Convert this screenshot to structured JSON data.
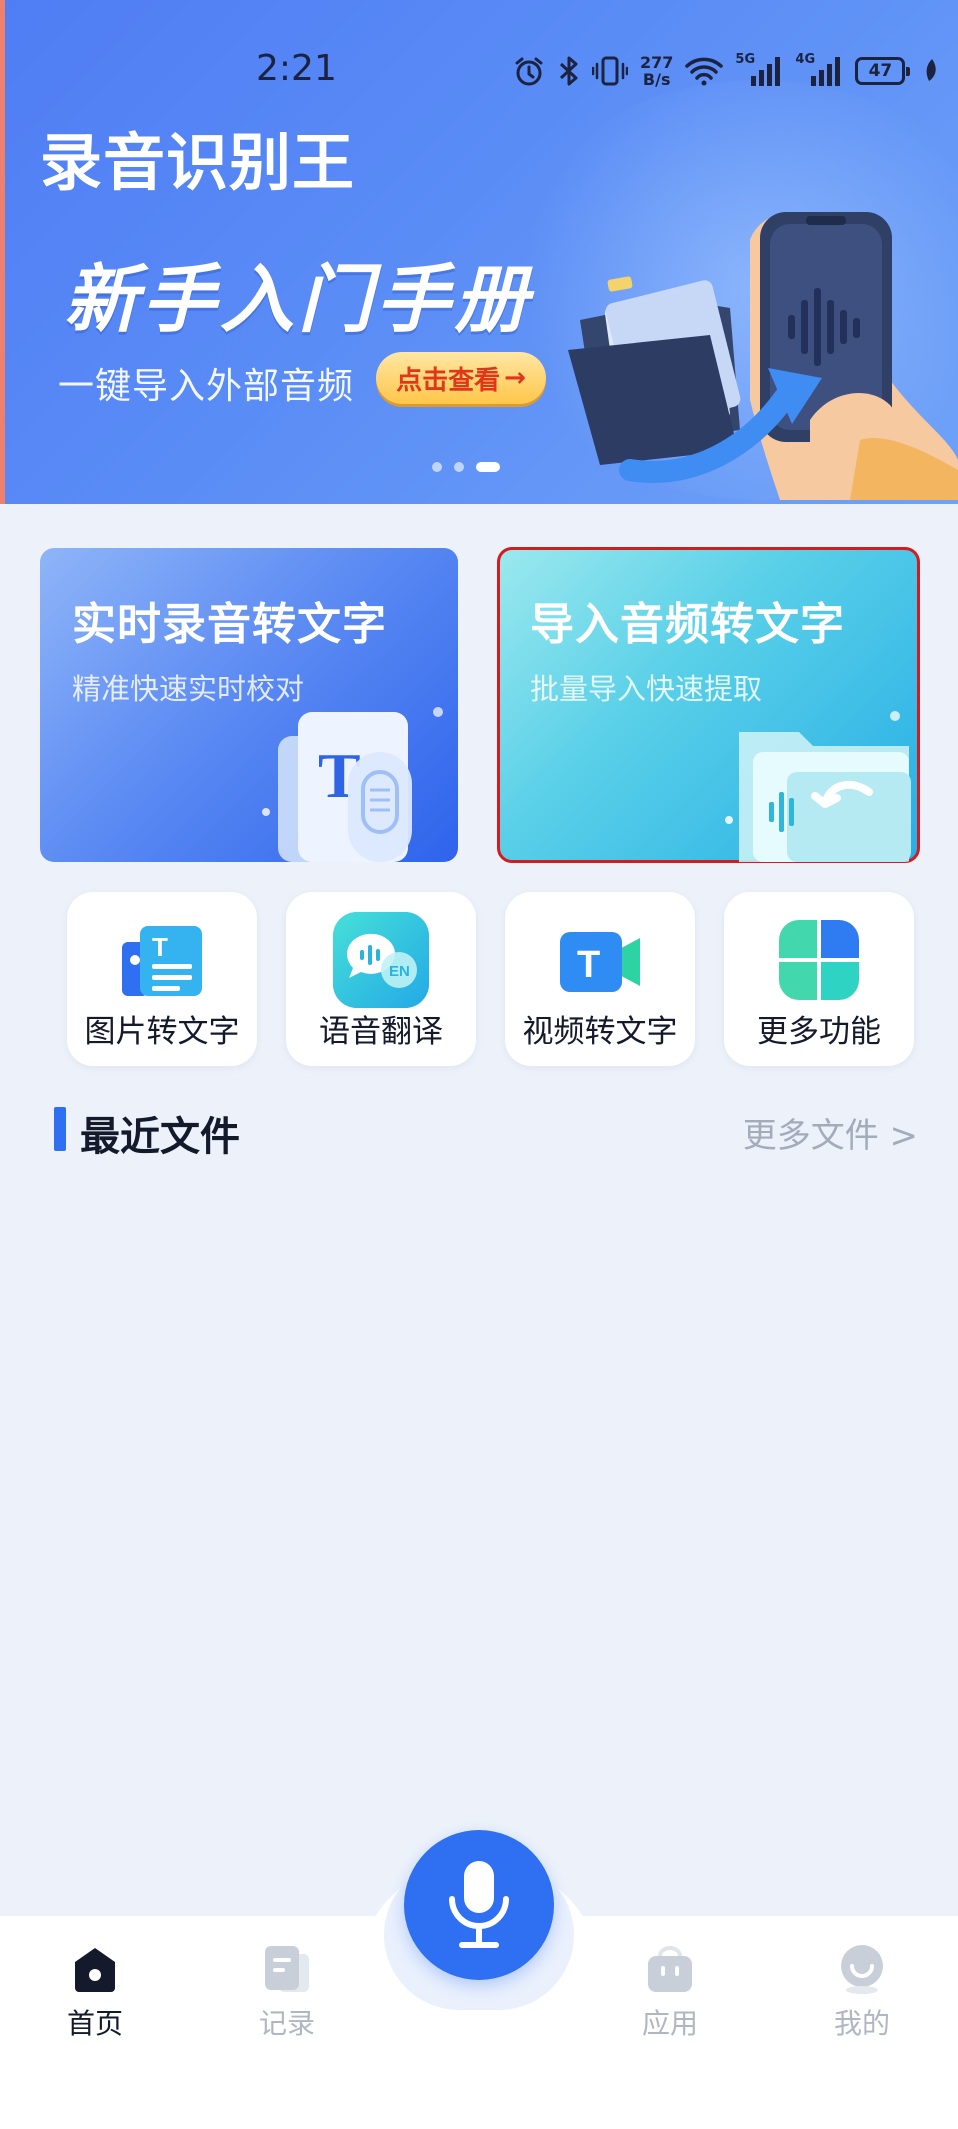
{
  "status_bar": {
    "time": "2:21",
    "net_speed_value": "277",
    "net_speed_unit": "B/s",
    "signal_1_label": "5G",
    "signal_2_label": "4G",
    "battery": "47"
  },
  "banner": {
    "app_title": "录音识别王",
    "headline": "新手入门手册",
    "subtitle": "一键导入外部音频",
    "cta_label": "点击查看",
    "cta_arrow": "→",
    "active_slide": 3,
    "slide_count": 3
  },
  "cards": [
    {
      "title": "实时录音转文字",
      "subtitle": "精准快速实时校对"
    },
    {
      "title": "导入音频转文字",
      "subtitle": "批量导入快速提取"
    }
  ],
  "tools": [
    {
      "label": "图片转文字",
      "icon": "image-text-icon"
    },
    {
      "label": "语音翻译",
      "icon": "voice-translate-icon"
    },
    {
      "label": "视频转文字",
      "icon": "video-text-icon"
    },
    {
      "label": "更多功能",
      "icon": "more-apps-icon"
    }
  ],
  "recent": {
    "title": "最近文件",
    "more_label": "更多文件 >"
  },
  "nav": {
    "items": [
      {
        "label": "首页",
        "icon": "home-icon",
        "active": true
      },
      {
        "label": "记录",
        "icon": "records-icon",
        "active": false
      },
      {
        "label": "应用",
        "icon": "apps-icon",
        "active": false
      },
      {
        "label": "我的",
        "icon": "profile-icon",
        "active": false
      }
    ],
    "record_button": "microphone-icon"
  },
  "colors": {
    "accent": "#2f6ff2",
    "banner_blue": "#5a8cf6",
    "cta_text": "#e0361b",
    "selection_outline": "#d51a20"
  }
}
